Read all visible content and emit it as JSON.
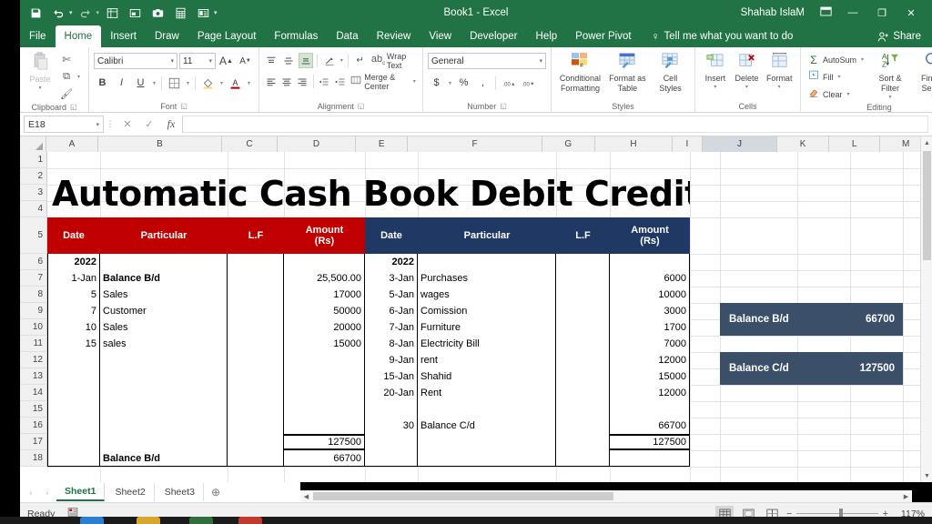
{
  "window": {
    "title": "Book1  -  Excel",
    "user": "Shahab IslaM",
    "ribbon_display_icon": "ribbon-display-options-icon",
    "minimize": "—",
    "restore": "❐",
    "close": "✕"
  },
  "quick_access": [
    {
      "name": "save-icon",
      "glyph": "ὋE"
    },
    {
      "name": "undo-icon",
      "glyph": "↶"
    },
    {
      "name": "redo-icon",
      "glyph": "↷"
    },
    {
      "name": "sort-filter-icon",
      "glyph": "▦"
    },
    {
      "name": "picture-icon",
      "glyph": "▣"
    },
    {
      "name": "camera-icon",
      "glyph": "◎"
    },
    {
      "name": "calculator-icon",
      "glyph": "▤"
    },
    {
      "name": "form-icon",
      "glyph": "▥"
    },
    {
      "name": "customize-qat-icon",
      "glyph": "⌄"
    }
  ],
  "tabs": [
    {
      "label": "File",
      "active": false
    },
    {
      "label": "Home",
      "active": true
    },
    {
      "label": "Insert",
      "active": false
    },
    {
      "label": "Draw",
      "active": false
    },
    {
      "label": "Page Layout",
      "active": false
    },
    {
      "label": "Formulas",
      "active": false
    },
    {
      "label": "Data",
      "active": false
    },
    {
      "label": "Review",
      "active": false
    },
    {
      "label": "View",
      "active": false
    },
    {
      "label": "Developer",
      "active": false
    },
    {
      "label": "Help",
      "active": false
    },
    {
      "label": "Power Pivot",
      "active": false
    }
  ],
  "tell_me": "Tell me what you want to do",
  "share": "Share",
  "ribbon": {
    "clipboard": {
      "label": "Clipboard",
      "paste": "Paste",
      "cut": "Cut",
      "copy": "Copy",
      "format_painter": "Format Painter"
    },
    "font": {
      "label": "Font",
      "font_name": "Calibri",
      "font_size": "11",
      "grow_font": "A",
      "shrink_font": "A",
      "bold": "B",
      "italic": "I",
      "underline": "U",
      "borders": "⊞",
      "fill_color": "▧",
      "font_color": "A"
    },
    "alignment": {
      "label": "Alignment",
      "wrap_text": "Wrap Text",
      "merge_center": "Merge & Center",
      "orientation": "⤨",
      "align_left": "≡",
      "align_center": "≡",
      "align_right": "≡",
      "top_align": "≡",
      "middle_align": "≡",
      "bottom_align": "≡",
      "decrease_indent": "←≡",
      "increase_indent": "→≡"
    },
    "number": {
      "label": "Number",
      "format": "General",
      "currency": "$",
      "percent": "%",
      "comma": ",",
      "increase_decimal": "←.0",
      "decrease_decimal": ".00→"
    },
    "styles": {
      "label": "Styles",
      "conditional_formatting": "Conditional\nFormatting",
      "conditional_formatting_l1": "Conditional",
      "conditional_formatting_l2": "Formatting",
      "format_as_table_l1": "Format as",
      "format_as_table_l2": "Table",
      "cell_styles_l1": "Cell",
      "cell_styles_l2": "Styles"
    },
    "cells": {
      "label": "Cells",
      "insert": "Insert",
      "delete": "Delete",
      "format": "Format"
    },
    "editing": {
      "label": "Editing",
      "autosum": "AutoSum",
      "fill": "Fill",
      "clear": "Clear",
      "sort_filter_l1": "Sort &",
      "sort_filter_l2": "Filter",
      "find_select_l1": "Find &",
      "find_select_l2": "Select"
    },
    "collapse_ribbon": "⌃"
  },
  "formula_bar": {
    "name_box": "E18",
    "cancel": "✕",
    "enter": "✓",
    "insert_function": "fx",
    "formula_value": ""
  },
  "grid": {
    "columns": [
      "A",
      "B",
      "C",
      "D",
      "E",
      "F",
      "G",
      "H",
      "I",
      "J",
      "K",
      "L",
      "M"
    ],
    "highlighted_column": "J",
    "rows": [
      "1",
      "2",
      "3",
      "4",
      "5",
      "6",
      "7",
      "8",
      "9",
      "10",
      "11",
      "12",
      "13",
      "14",
      "15",
      "16",
      "17",
      "18"
    ]
  },
  "sheet_content": {
    "title": "Automatic Cash Book  Debit Credit",
    "debit_header": {
      "date": "Date",
      "particular": "Particular",
      "lf": "L.F",
      "amount_line1": "Amount",
      "amount_line2": "(Rs)"
    },
    "credit_header": {
      "date": "Date",
      "particular": "Particular",
      "lf": "L.F",
      "amount_line1": "Amount",
      "amount_line2": "(Rs)"
    },
    "debit_year": "2022",
    "credit_year": "2022",
    "debit_rows": [
      {
        "date": "1-Jan",
        "particular": "Balance B/d",
        "lf": "",
        "amount": "25,500.00",
        "bold": true
      },
      {
        "date": "5",
        "particular": "Sales",
        "lf": "",
        "amount": "17000",
        "bold": false
      },
      {
        "date": "7",
        "particular": "Customer",
        "lf": "",
        "amount": "50000",
        "bold": false
      },
      {
        "date": "10",
        "particular": "Sales",
        "lf": "",
        "amount": "20000",
        "bold": false
      },
      {
        "date": "15",
        "particular": "sales",
        "lf": "",
        "amount": "15000",
        "bold": false
      }
    ],
    "credit_rows": [
      {
        "date": "3-Jan",
        "particular": "Purchases",
        "lf": "",
        "amount": "6000"
      },
      {
        "date": "5-Jan",
        "particular": "wages",
        "lf": "",
        "amount": "10000"
      },
      {
        "date": "6-Jan",
        "particular": "Comission",
        "lf": "",
        "amount": "3000"
      },
      {
        "date": "7-Jan",
        "particular": "Furniture",
        "lf": "",
        "amount": "1700"
      },
      {
        "date": "8-Jan",
        "particular": "Electricity Bill",
        "lf": "",
        "amount": "7000"
      },
      {
        "date": "9-Jan",
        "particular": "rent",
        "lf": "",
        "amount": "12000"
      },
      {
        "date": "15-Jan",
        "particular": "Shahid",
        "lf": "",
        "amount": "15000"
      },
      {
        "date": "20-Jan",
        "particular": "Rent",
        "lf": "",
        "amount": "12000"
      }
    ],
    "credit_balance_cd": {
      "date": "30",
      "particular": "Balance C/d",
      "amount": "66700"
    },
    "debit_total": "127500",
    "credit_total": "127500",
    "debit_balance_bd": {
      "particular": "Balance B/d",
      "amount": "66700"
    },
    "summary_boxes": [
      {
        "label": "Balance B/d",
        "value": "66700"
      },
      {
        "label": "Balance C/d",
        "value": "127500"
      }
    ]
  },
  "sheet_tabs": {
    "prev": "‹",
    "next": "›",
    "tabs": [
      {
        "label": "Sheet1",
        "active": true
      },
      {
        "label": "Sheet2",
        "active": false
      },
      {
        "label": "Sheet3",
        "active": false
      }
    ],
    "add": "⊕"
  },
  "status_bar": {
    "status": "Ready",
    "accessibility_icon": "accessibility-checker-icon",
    "view_normal": "▦",
    "view_page_layout": "▤",
    "view_page_break": "▥",
    "zoom_out": "−",
    "zoom_in": "+",
    "zoom_level": "117%"
  },
  "colors": {
    "excel_green": "#217346",
    "debit_header_red": "#c00000",
    "credit_header_blue": "#1f3864",
    "summary_box_slate": "#3b5068"
  }
}
